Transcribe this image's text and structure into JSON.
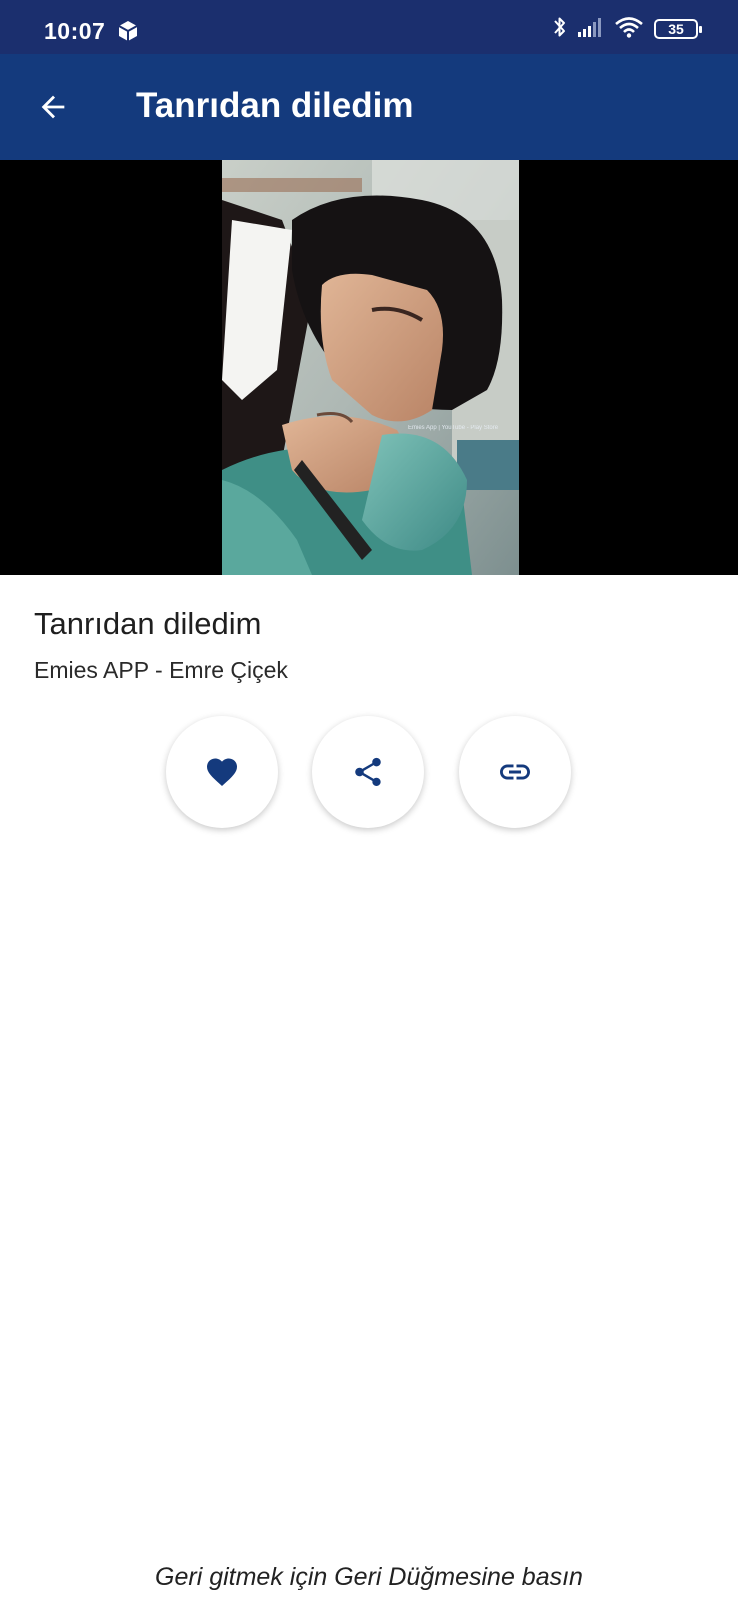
{
  "status_bar": {
    "time": "10:07",
    "battery": "35",
    "icons": [
      "cube-notification-icon",
      "bluetooth-icon",
      "signal-icon",
      "wifi-icon",
      "battery-icon"
    ]
  },
  "app_bar": {
    "title": "Tanrıdan diledim",
    "back_icon": "arrow-back-icon"
  },
  "media": {
    "watermark": "Emies App | YouTube - Play Store"
  },
  "song": {
    "title": "Tanrıdan diledim",
    "artist": "Emies APP - Emre Çiçek"
  },
  "actions": [
    {
      "name": "favorite",
      "icon": "heart-icon"
    },
    {
      "name": "share",
      "icon": "share-icon"
    },
    {
      "name": "copy-link",
      "icon": "link-icon"
    }
  ],
  "footer": {
    "hint": "Geri gitmek için Geri Düğmesine basın"
  },
  "colors": {
    "status_bar": "#1b2f6e",
    "app_bar": "#143a7d",
    "accent_icon": "#143a7d",
    "background": "#ffffff"
  }
}
